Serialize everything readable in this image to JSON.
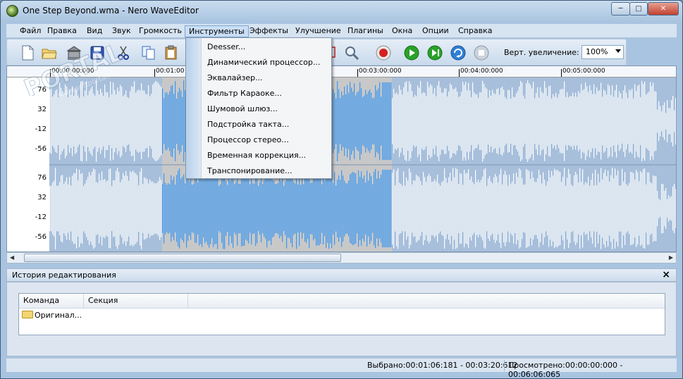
{
  "window": {
    "title": "One Step Beyond.wma - Nero WaveEditor"
  },
  "menubar": {
    "items": [
      {
        "label": "Файл"
      },
      {
        "label": "Правка"
      },
      {
        "label": "Вид"
      },
      {
        "label": "Звук"
      },
      {
        "label": "Громкость"
      },
      {
        "label": "Инструменты"
      },
      {
        "label": "Эффекты"
      },
      {
        "label": "Улучшение"
      },
      {
        "label": "Плагины"
      },
      {
        "label": "Окна"
      },
      {
        "label": "Опции"
      },
      {
        "label": "Справка"
      }
    ],
    "active": "Инструменты"
  },
  "dropdown": {
    "items": [
      {
        "label": "Deesser..."
      },
      {
        "label": "Динамический процессор..."
      },
      {
        "label": "Эквалайзер..."
      },
      {
        "label": "Фильтр Караоке..."
      },
      {
        "label": "Шумовой шлюз..."
      },
      {
        "label": "Подстройка такта..."
      },
      {
        "label": "Процессор стерео..."
      },
      {
        "label": "Временная коррекция..."
      },
      {
        "label": "Транспонирование..."
      }
    ]
  },
  "toolbar": {
    "zoom_label": "Верт. увеличение:",
    "zoom_value": "100%",
    "icons": [
      "new-file-icon",
      "open-folder-icon",
      "archive-icon",
      "save-icon",
      "cut-icon",
      "copy-icon",
      "paste-icon",
      "crop-icon",
      "zoom-icon",
      "record-icon",
      "play-icon",
      "play-selection-icon",
      "loop-icon",
      "stop-icon"
    ],
    "colors": {
      "record": "#d42020",
      "play": "#2aa12a",
      "loop": "#2f7fd6",
      "stop": "#9aa7b5"
    }
  },
  "ruler": {
    "labels": [
      "00:00:00:000",
      "00:01:00",
      "00:03:00:000",
      "00:04:00:000",
      "00:05:00:000"
    ]
  },
  "yaxis": {
    "top_channel": [
      "76",
      "32",
      "-12",
      "-56"
    ],
    "bottom_channel": [
      "76",
      "32",
      "-12",
      "-56"
    ]
  },
  "waveform": {
    "colors": {
      "background": "#a7bfdb",
      "wave": "#ffffff",
      "selection_bg": "#c8c8c8",
      "selection_wave": "#3b97f0"
    },
    "selection_label": "Выбрано"
  },
  "history": {
    "title": "История редактирования",
    "columns": [
      "Команда",
      "Секция"
    ],
    "rows": [
      {
        "command": "Оригинал..."
      }
    ]
  },
  "statusbar": {
    "selected": "Выбрано:00:01:06:181 - 00:03:20:612",
    "viewed": "Просмотрено:00:00:00:000 - 00:06:06:065"
  },
  "watermark": {
    "text": "PORTAL",
    "subtext": "www.softportal.com"
  }
}
